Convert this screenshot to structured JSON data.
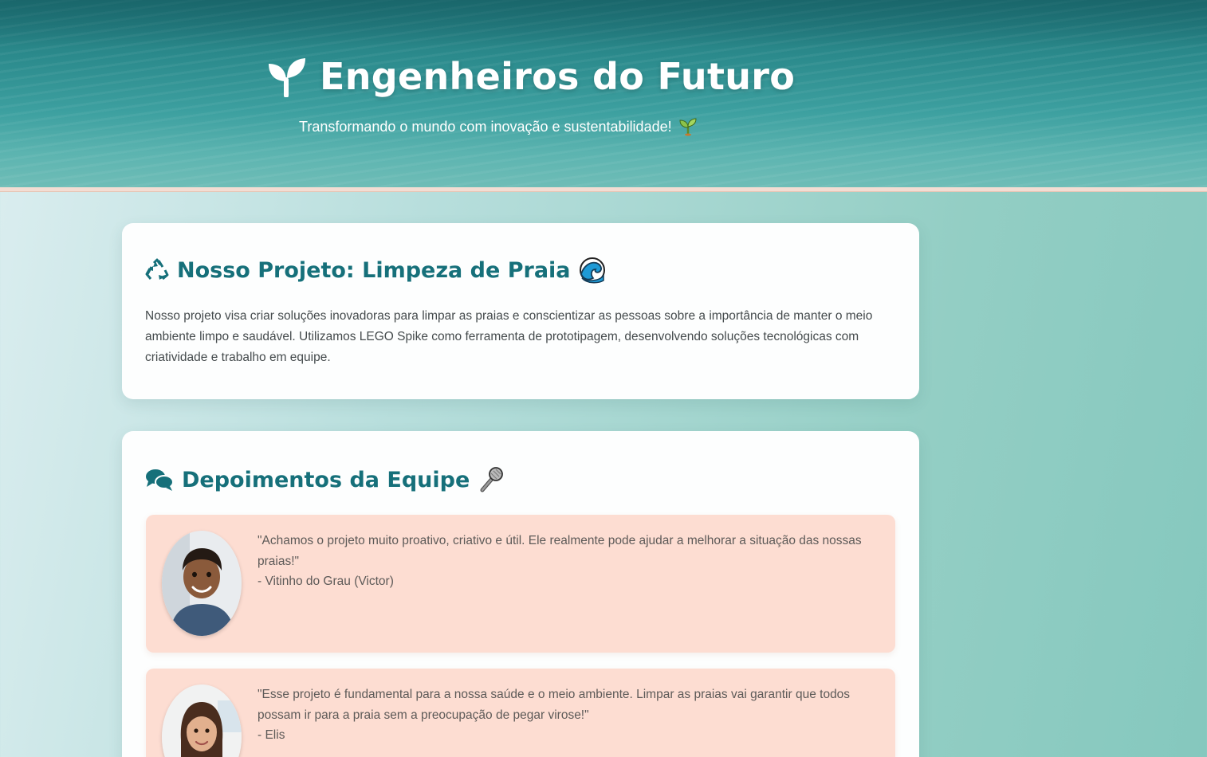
{
  "header": {
    "title": "Engenheiros do Futuro",
    "title_icon": "seedling-icon",
    "subtitle": "Transformando o mundo com inovação e sustentabilidade!",
    "subtitle_emoji": "seedling-emoji"
  },
  "project": {
    "title": "Nosso Projeto: Limpeza de Praia",
    "title_icon": "recycle-icon",
    "title_emoji": "wave-emoji",
    "text": "Nosso projeto visa criar soluções inovadoras para limpar as praias e conscientizar as pessoas sobre a importância de manter o meio ambiente limpo e saudável. Utilizamos LEGO Spike como ferramenta de prototipagem, desenvolvendo soluções tecnológicas com criatividade e trabalho em equipe."
  },
  "testimonials": {
    "title": "Depoimentos da Equipe",
    "title_icon": "comments-icon",
    "title_emoji": "microphone-emoji",
    "items": [
      {
        "quote": "\"Achamos o projeto muito proativo, criativo e útil. Ele realmente pode ajudar a melhorar a situação das nossas praias!\"",
        "author": "- Vitinho do Grau (Victor)"
      },
      {
        "quote": "\"Esse projeto é fundamental para a nossa saúde e o meio ambiente. Limpar as praias vai garantir que todos possam ir para a praia sem a preocupação de pegar virose!\"",
        "author": "- Elis"
      }
    ]
  },
  "colors": {
    "heading": "#16707a",
    "testimonial_bg": "#fdddd2",
    "header_accent": "#f3ddd3"
  }
}
